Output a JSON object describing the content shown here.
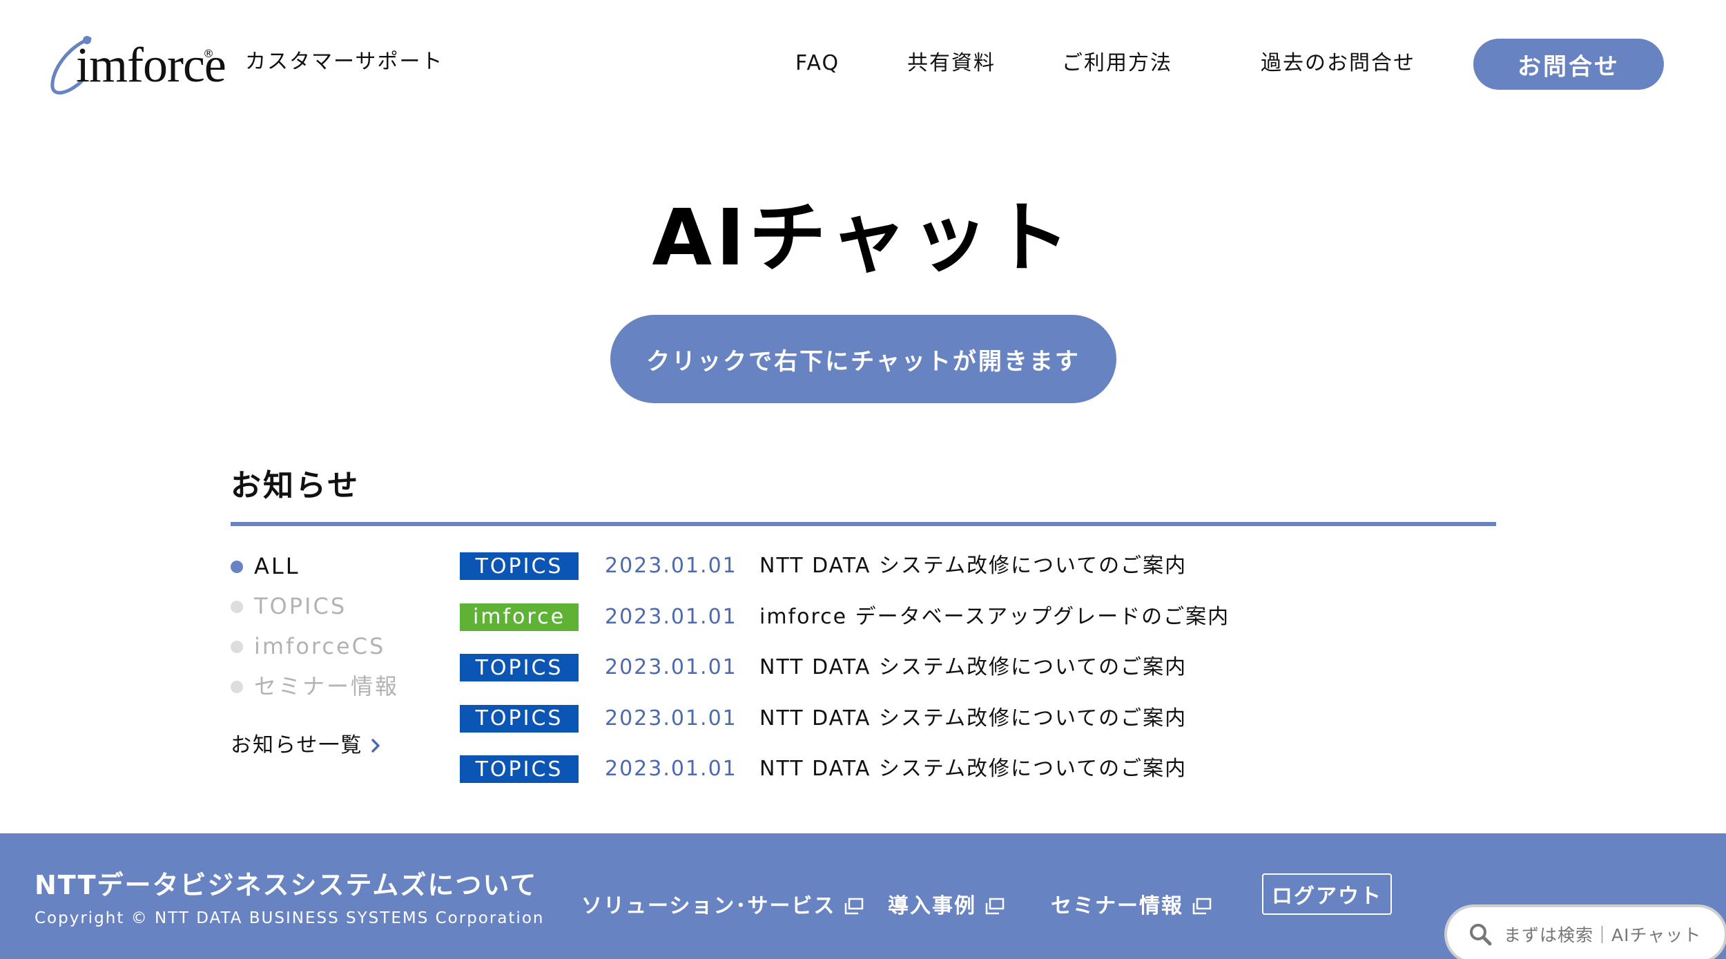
{
  "header": {
    "logo_text": "imforce",
    "logo_reg": "®",
    "subtitle": "カスタマーサポート",
    "nav": {
      "faq": "FAQ",
      "shared": "共有資料",
      "howto": "ご利用方法",
      "history": "過去のお問合せ"
    },
    "contact_label": "お問合せ"
  },
  "hero": {
    "title": "AIチャット",
    "chat_button_label": "クリックで右下にチャットが開きます"
  },
  "news": {
    "heading": "お知らせ",
    "filters": [
      {
        "label": "ALL",
        "active": true
      },
      {
        "label": "TOPICS",
        "active": false
      },
      {
        "label": "imforceCS",
        "active": false
      },
      {
        "label": "セミナー情報",
        "active": false
      }
    ],
    "all_link_label": "お知らせ一覧",
    "items": [
      {
        "tag": "TOPICS",
        "tag_color": "#0b55b5",
        "date": "2023.01.01",
        "title": "NTT DATA システム改修についてのご案内"
      },
      {
        "tag": "imforce",
        "tag_color": "#5eb234",
        "date": "2023.01.01",
        "title": "imforce データベースアップグレードのご案内"
      },
      {
        "tag": "TOPICS",
        "tag_color": "#0b55b5",
        "date": "2023.01.01",
        "title": "NTT DATA システム改修についてのご案内"
      },
      {
        "tag": "TOPICS",
        "tag_color": "#0b55b5",
        "date": "2023.01.01",
        "title": "NTT DATA システム改修についてのご案内"
      },
      {
        "tag": "TOPICS",
        "tag_color": "#0b55b5",
        "date": "2023.01.01",
        "title": "NTT DATA システム改修についてのご案内"
      }
    ]
  },
  "footer": {
    "company_link": "NTTデータビジネスシステムズについて",
    "copyright": "Copyright © NTT DATA BUSINESS SYSTEMS Corporation",
    "links": {
      "solutions": "ソリューション･サービス",
      "cases": "導入事例",
      "seminar": "セミナー情報"
    },
    "logout_label": "ログアウト"
  },
  "search_widget": {
    "text": "まずは検索｜AIチャット"
  },
  "colors": {
    "accent": "#6883c2",
    "topics_tag": "#0b55b5",
    "imforce_tag": "#5eb234",
    "date_text": "#4d6ab0"
  },
  "icons": {
    "external": "external-link-icon",
    "chevron": "chevron-right-icon",
    "search": "search-icon"
  }
}
